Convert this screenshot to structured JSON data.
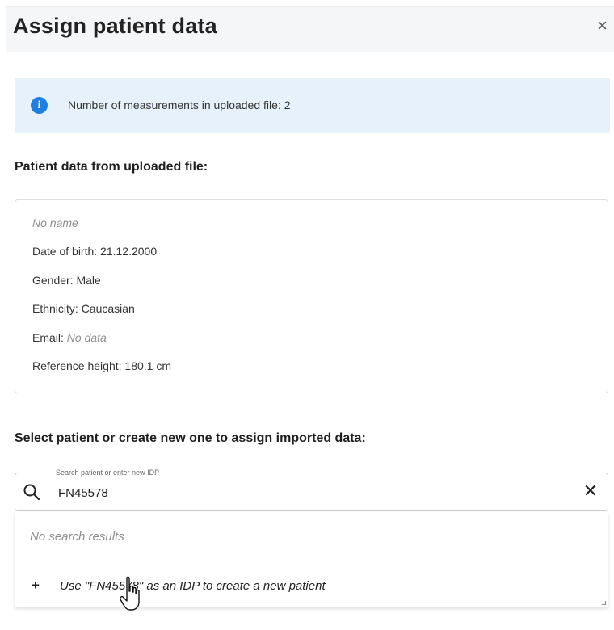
{
  "dialog": {
    "title": "Assign patient data",
    "close_icon": "×"
  },
  "info": {
    "icon": "info-icon",
    "text": "Number of measurements in uploaded file: 2"
  },
  "uploaded": {
    "heading": "Patient data from uploaded file:",
    "name": "No name",
    "dob": "Date of birth: 21.12.2000",
    "gender": "Gender: Male",
    "ethnicity": "Ethnicity: Caucasian",
    "email_label": "Email: ",
    "email_value": "No data",
    "height": "Reference height: 180.1 cm"
  },
  "select": {
    "heading": "Select patient or create new one to assign imported data:"
  },
  "search": {
    "label": "Search patient or enter new IDP",
    "value": "FN45578",
    "clear_icon": "✕"
  },
  "dropdown": {
    "no_results": "No search results",
    "create_icon": "+",
    "create_label": "Use \"FN45578\" as an IDP to create a new patient"
  },
  "colors": {
    "accent": "#1e7fe0",
    "info_bg": "#e7f1fb",
    "header_bg": "#f5f6f8"
  }
}
